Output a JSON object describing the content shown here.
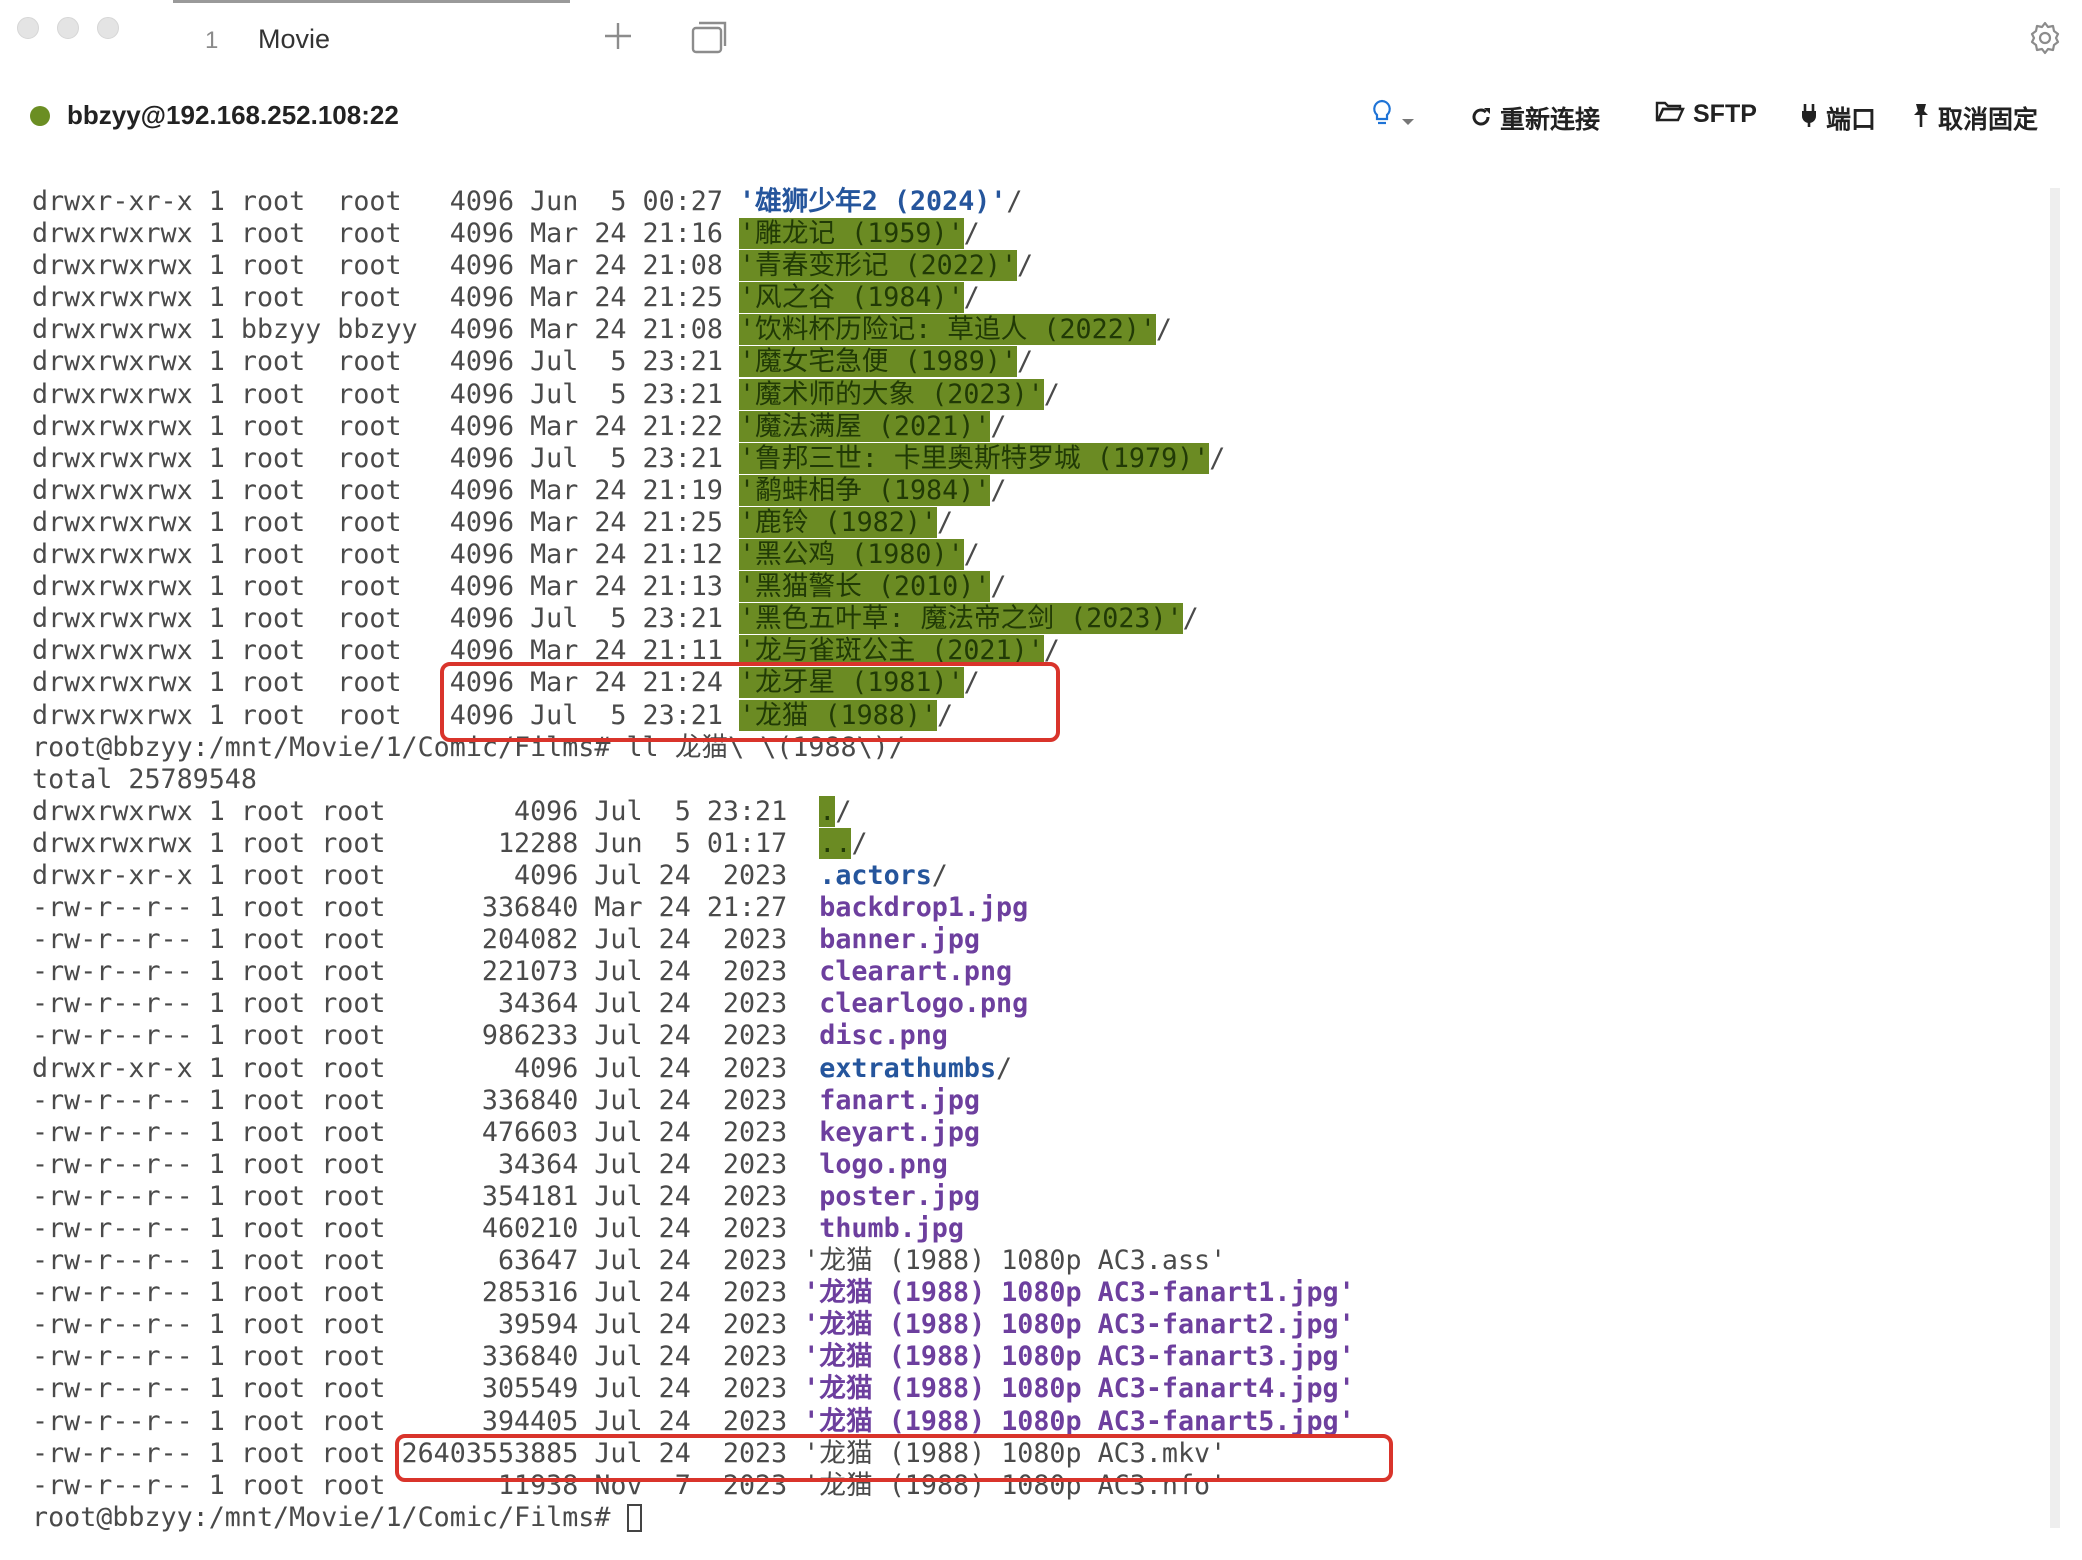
{
  "tabs": [
    {
      "index": "1",
      "title": "Movie"
    }
  ],
  "status": {
    "connection": "bbzyy@192.168.252.108:22",
    "actions": {
      "reconnect": "重新连接",
      "sftp": "SFTP",
      "port": "端口",
      "unpin": "取消固定"
    }
  },
  "colors": {
    "connected": "#6b8e23",
    "highlight_bg": "#6b8b23",
    "directory": "#25559c",
    "image_file": "#6d3f9e",
    "annotation": "#d9342b"
  },
  "icons": {
    "new_tab": "plus-icon",
    "tab_overview": "window-icon",
    "settings": "gear-icon",
    "hint": "lightbulb-icon"
  },
  "terminal": {
    "lines": [
      {
        "p": "drwxr-xr-x 1 root  root   4096 Jun  5 00:27 ",
        "n": "'雄狮少年2 (2024)'",
        "s": "/",
        "c": "blue"
      },
      {
        "p": "drwxrwxrwx 1 root  root   4096 Mar 24 21:16 ",
        "n": "'雕龙记 (1959)'",
        "s": "/",
        "c": "hl"
      },
      {
        "p": "drwxrwxrwx 1 root  root   4096 Mar 24 21:08 ",
        "n": "'青春变形记 (2022)'",
        "s": "/",
        "c": "hl"
      },
      {
        "p": "drwxrwxrwx 1 root  root   4096 Mar 24 21:25 ",
        "n": "'风之谷 (1984)'",
        "s": "/",
        "c": "hl"
      },
      {
        "p": "drwxrwxrwx 1 bbzyy bbzyy  4096 Mar 24 21:08 ",
        "n": "'饮料杯历险记: 草追人 (2022)'",
        "s": "/",
        "c": "hl"
      },
      {
        "p": "drwxrwxrwx 1 root  root   4096 Jul  5 23:21 ",
        "n": "'魔女宅急便 (1989)'",
        "s": "/",
        "c": "hl"
      },
      {
        "p": "drwxrwxrwx 1 root  root   4096 Jul  5 23:21 ",
        "n": "'魔术师的大象 (2023)'",
        "s": "/",
        "c": "hl"
      },
      {
        "p": "drwxrwxrwx 1 root  root   4096 Mar 24 21:22 ",
        "n": "'魔法满屋 (2021)'",
        "s": "/",
        "c": "hl"
      },
      {
        "p": "drwxrwxrwx 1 root  root   4096 Jul  5 23:21 ",
        "n": "'鲁邦三世: 卡里奥斯特罗城 (1979)'",
        "s": "/",
        "c": "hl"
      },
      {
        "p": "drwxrwxrwx 1 root  root   4096 Mar 24 21:19 ",
        "n": "'鹬蚌相争 (1984)'",
        "s": "/",
        "c": "hl"
      },
      {
        "p": "drwxrwxrwx 1 root  root   4096 Mar 24 21:25 ",
        "n": "'鹿铃 (1982)'",
        "s": "/",
        "c": "hl"
      },
      {
        "p": "drwxrwxrwx 1 root  root   4096 Mar 24 21:12 ",
        "n": "'黑公鸡 (1980)'",
        "s": "/",
        "c": "hl"
      },
      {
        "p": "drwxrwxrwx 1 root  root   4096 Mar 24 21:13 ",
        "n": "'黑猫警长 (2010)'",
        "s": "/",
        "c": "hl"
      },
      {
        "p": "drwxrwxrwx 1 root  root   4096 Jul  5 23:21 ",
        "n": "'黑色五叶草: 魔法帝之剑 (2023)'",
        "s": "/",
        "c": "hl"
      },
      {
        "p": "drwxrwxrwx 1 root  root   4096 Mar 24 21:11 ",
        "n": "'龙与雀斑公主 (2021)'",
        "s": "/",
        "c": "hl"
      },
      {
        "p": "drwxrwxrwx 1 root  root   4096 Mar 24 21:24 ",
        "n": "'龙牙星 (1981)'",
        "s": "/",
        "c": "hl"
      },
      {
        "p": "drwxrwxrwx 1 root  root   4096 Jul  5 23:21 ",
        "n": "'龙猫 (1988)'",
        "s": "/",
        "c": "hl"
      },
      {
        "p": "root@bbzyy:/mnt/Movie/1/Comic/Films# ll 龙猫\\ \\(1988\\)/",
        "n": "",
        "s": "",
        "c": ""
      },
      {
        "p": "total 25789548",
        "n": "",
        "s": "",
        "c": ""
      },
      {
        "p": "drwxrwxrwx 1 root root        4096 Jul  5 23:21  ",
        "n": ".",
        "s": "/",
        "c": "hl"
      },
      {
        "p": "drwxrwxrwx 1 root root       12288 Jun  5 01:17  ",
        "n": "..",
        "s": "/",
        "c": "hl"
      },
      {
        "p": "drwxr-xr-x 1 root root        4096 Jul 24  2023  ",
        "n": ".actors",
        "s": "/",
        "c": "blue"
      },
      {
        "p": "-rw-r--r-- 1 root root      336840 Mar 24 21:27  ",
        "n": "backdrop1.jpg",
        "s": "",
        "c": "purple"
      },
      {
        "p": "-rw-r--r-- 1 root root      204082 Jul 24  2023  ",
        "n": "banner.jpg",
        "s": "",
        "c": "purple"
      },
      {
        "p": "-rw-r--r-- 1 root root      221073 Jul 24  2023  ",
        "n": "clearart.png",
        "s": "",
        "c": "purple"
      },
      {
        "p": "-rw-r--r-- 1 root root       34364 Jul 24  2023  ",
        "n": "clearlogo.png",
        "s": "",
        "c": "purple"
      },
      {
        "p": "-rw-r--r-- 1 root root      986233 Jul 24  2023  ",
        "n": "disc.png",
        "s": "",
        "c": "purple"
      },
      {
        "p": "drwxr-xr-x 1 root root        4096 Jul 24  2023  ",
        "n": "extrathumbs",
        "s": "/",
        "c": "blue"
      },
      {
        "p": "-rw-r--r-- 1 root root      336840 Jul 24  2023  ",
        "n": "fanart.jpg",
        "s": "",
        "c": "purple"
      },
      {
        "p": "-rw-r--r-- 1 root root      476603 Jul 24  2023  ",
        "n": "keyart.jpg",
        "s": "",
        "c": "purple"
      },
      {
        "p": "-rw-r--r-- 1 root root       34364 Jul 24  2023  ",
        "n": "logo.png",
        "s": "",
        "c": "purple"
      },
      {
        "p": "-rw-r--r-- 1 root root      354181 Jul 24  2023  ",
        "n": "poster.jpg",
        "s": "",
        "c": "purple"
      },
      {
        "p": "-rw-r--r-- 1 root root      460210 Jul 24  2023  ",
        "n": "thumb.jpg",
        "s": "",
        "c": "purple"
      },
      {
        "p": "-rw-r--r-- 1 root root       63647 Jul 24  2023 '龙猫 (1988) 1080p AC3.ass'",
        "n": "",
        "s": "",
        "c": ""
      },
      {
        "p": "-rw-r--r-- 1 root root      285316 Jul 24  2023 ",
        "n": "'龙猫 (1988) 1080p AC3-fanart1.jpg'",
        "s": "",
        "c": "purple"
      },
      {
        "p": "-rw-r--r-- 1 root root       39594 Jul 24  2023 ",
        "n": "'龙猫 (1988) 1080p AC3-fanart2.jpg'",
        "s": "",
        "c": "purple"
      },
      {
        "p": "-rw-r--r-- 1 root root      336840 Jul 24  2023 ",
        "n": "'龙猫 (1988) 1080p AC3-fanart3.jpg'",
        "s": "",
        "c": "purple"
      },
      {
        "p": "-rw-r--r-- 1 root root      305549 Jul 24  2023 ",
        "n": "'龙猫 (1988) 1080p AC3-fanart4.jpg'",
        "s": "",
        "c": "purple"
      },
      {
        "p": "-rw-r--r-- 1 root root      394405 Jul 24  2023 ",
        "n": "'龙猫 (1988) 1080p AC3-fanart5.jpg'",
        "s": "",
        "c": "purple"
      },
      {
        "p": "-rw-r--r-- 1 root root 26403553885 Jul 24  2023 '龙猫 (1988) 1080p AC3.mkv'",
        "n": "",
        "s": "",
        "c": ""
      },
      {
        "p": "-rw-r--r-- 1 root root       11938 Nov  7  2023 '龙猫 (1988) 1080p AC3.nfo'",
        "n": "",
        "s": "",
        "c": ""
      },
      {
        "p": "root@bbzyy:/mnt/Movie/1/Comic/Films# ",
        "n": "",
        "s": "",
        "c": "",
        "cursor": true
      }
    ]
  }
}
